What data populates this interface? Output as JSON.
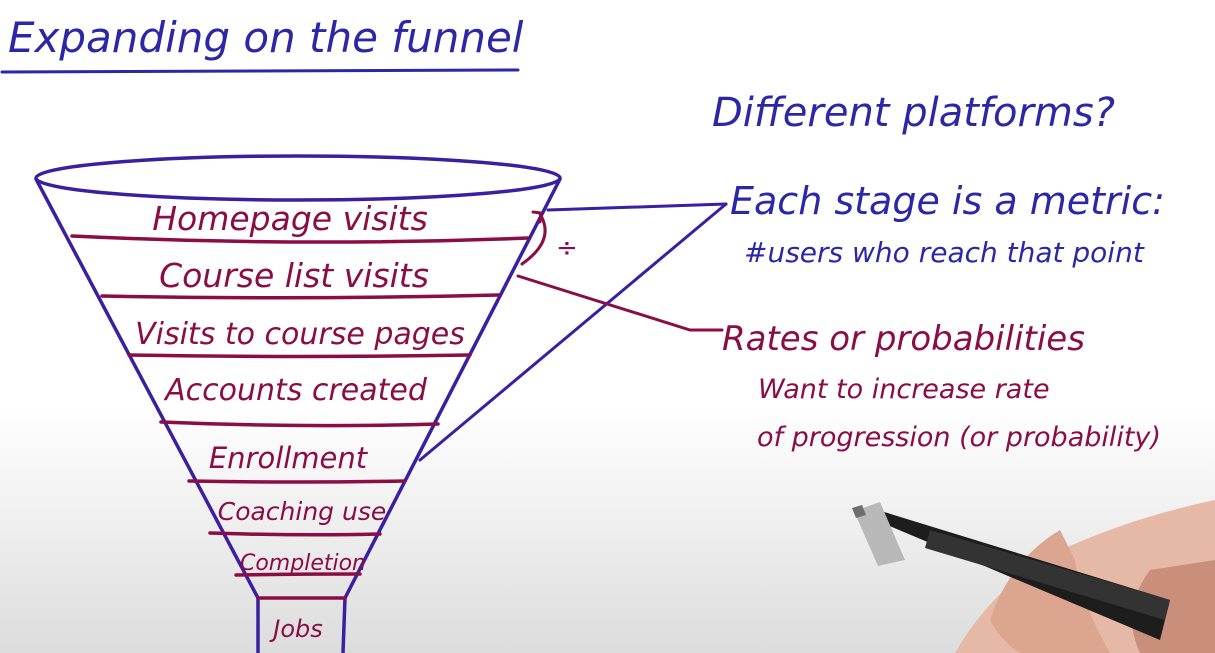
{
  "title": "Expanding on the funnel",
  "funnel_stages": [
    "Homepage visits",
    "Course list visits",
    "Visits to course pages",
    "Accounts created",
    "Enrollment",
    "Coaching use",
    "Completion",
    "Jobs"
  ],
  "divide_symbol": "÷",
  "question": "Different platforms?",
  "note_metric": {
    "heading": "Each stage is a metric:",
    "detail": "#users who reach that point"
  },
  "note_rates": {
    "heading": "Rates or probabilities",
    "detail_line1": "Want to increase rate",
    "detail_line2": "of progression (or probability)"
  },
  "colors": {
    "blue_ink": "#2c27a6",
    "plum_ink": "#8b0d46"
  }
}
